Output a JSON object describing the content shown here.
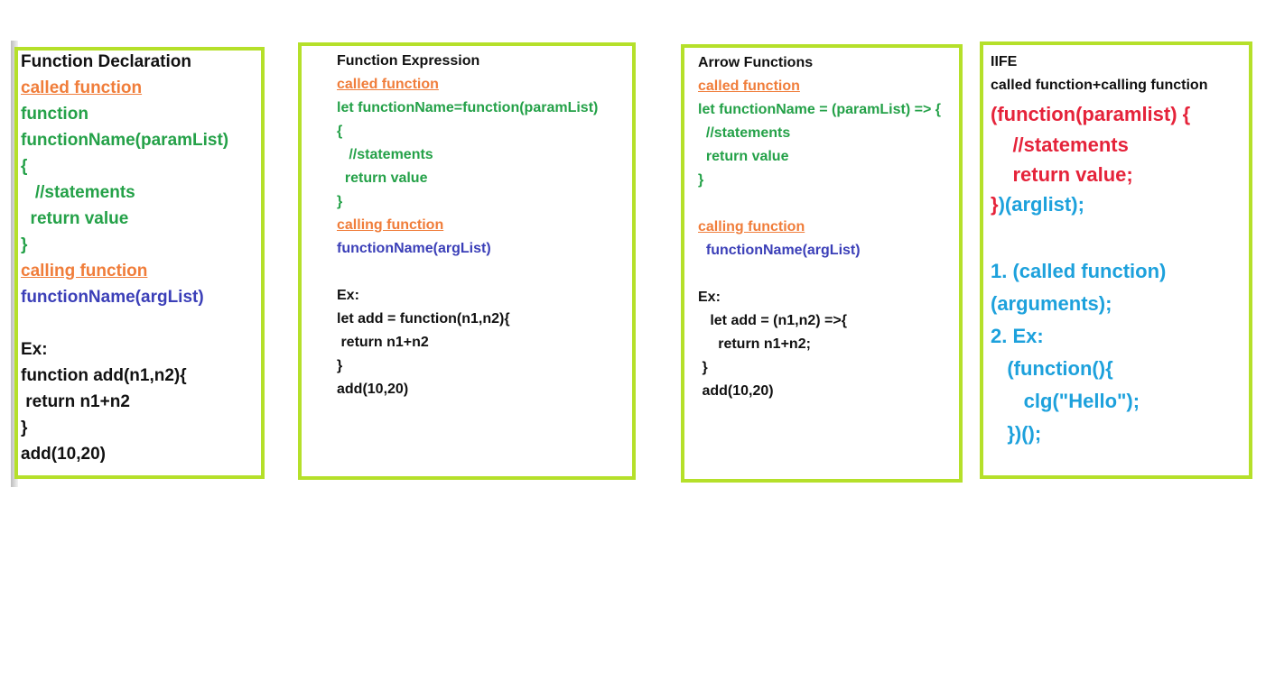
{
  "panels": [
    {
      "id": "function-declaration",
      "lines": [
        {
          "text": "Function Declaration",
          "role": "title"
        },
        {
          "text": "called function",
          "role": "section"
        },
        {
          "text": "function",
          "role": "code"
        },
        {
          "text": "functionName(paramList)",
          "role": "code"
        },
        {
          "text": "{",
          "role": "code"
        },
        {
          "text": "   //statements",
          "role": "code"
        },
        {
          "text": "  return value",
          "role": "code"
        },
        {
          "text": "}",
          "role": "code"
        },
        {
          "text": "calling function",
          "role": "section"
        },
        {
          "text": "functionName(argList)",
          "role": "call"
        },
        {
          "text": "Ex:",
          "role": "example"
        },
        {
          "text": "function add(n1,n2){",
          "role": "example"
        },
        {
          "text": " return n1+n2",
          "role": "example"
        },
        {
          "text": "}",
          "role": "example"
        },
        {
          "text": "add(10,20)",
          "role": "example"
        }
      ]
    },
    {
      "id": "function-expression",
      "lines": [
        {
          "text": "Function Expression",
          "role": "title"
        },
        {
          "text": "called function",
          "role": "section"
        },
        {
          "text": "let functionName=function(paramList)",
          "role": "code"
        },
        {
          "text": "{",
          "role": "code"
        },
        {
          "text": "   //statements",
          "role": "code"
        },
        {
          "text": "  return value",
          "role": "code"
        },
        {
          "text": "}",
          "role": "code"
        },
        {
          "text": "calling function",
          "role": "section"
        },
        {
          "text": "functionName(argList)",
          "role": "call"
        },
        {
          "text": "Ex:",
          "role": "example"
        },
        {
          "text": "let add = function(n1,n2){",
          "role": "example"
        },
        {
          "text": " return n1+n2",
          "role": "example"
        },
        {
          "text": "}",
          "role": "example"
        },
        {
          "text": "add(10,20)",
          "role": "example"
        }
      ]
    },
    {
      "id": "arrow-functions",
      "lines": [
        {
          "text": "Arrow Functions",
          "role": "title"
        },
        {
          "text": "called function",
          "role": "section"
        },
        {
          "text": "let functionName = (paramList) => {",
          "role": "code"
        },
        {
          "text": "  //statements",
          "role": "code"
        },
        {
          "text": "  return value",
          "role": "code"
        },
        {
          "text": "}",
          "role": "code"
        },
        {
          "text": "calling function",
          "role": "section"
        },
        {
          "text": "  functionName(argList)",
          "role": "call"
        },
        {
          "text": "Ex:",
          "role": "example"
        },
        {
          "text": "   let add = (n1,n2) =>{",
          "role": "example"
        },
        {
          "text": "     return n1+n2;",
          "role": "example"
        },
        {
          "text": " }",
          "role": "example"
        },
        {
          "text": " add(10,20)",
          "role": "example"
        }
      ]
    },
    {
      "id": "iife",
      "lines": [
        {
          "text": "IIFE",
          "role": "title"
        },
        {
          "text": "called function+calling function",
          "role": "title"
        },
        {
          "text": "(function(paramlist) {",
          "role": "iife-head"
        },
        {
          "text": "    //statements",
          "role": "iife-body"
        },
        {
          "text": "    return value;",
          "role": "iife-body"
        },
        {
          "text": "})(arglist);",
          "role": "iife-close"
        },
        {
          "text": "1. (called function)",
          "role": "note"
        },
        {
          "text": "(arguments);",
          "role": "note"
        },
        {
          "text": "2. Ex:",
          "role": "note"
        },
        {
          "text": "   (function(){",
          "role": "note"
        },
        {
          "text": "      clg(\"Hello\");",
          "role": "note"
        },
        {
          "text": "   })();",
          "role": "note"
        }
      ]
    }
  ],
  "colors": {
    "border": "#b5e02a",
    "title": "#111111",
    "section": "#f07d3a",
    "code": "#24a148",
    "call": "#3b3fb8",
    "example": "#111111",
    "iife_red": "#e5233a",
    "iife_cyan": "#1da1dc"
  }
}
